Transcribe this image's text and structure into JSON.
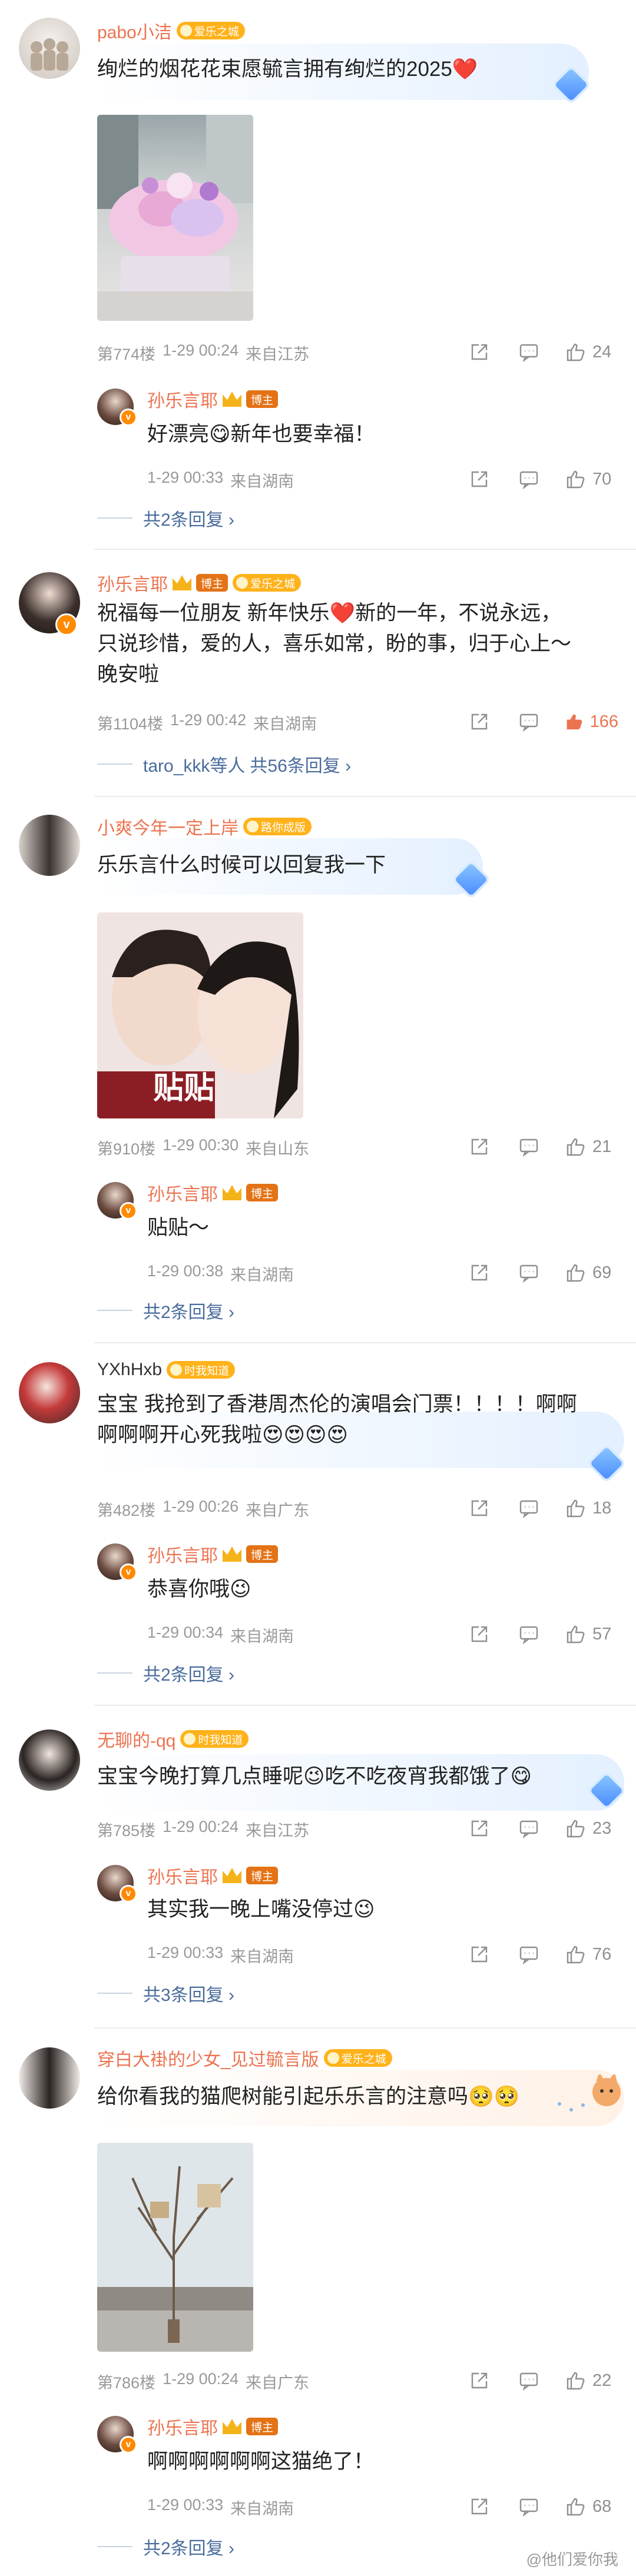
{
  "colors": {
    "name": "#eb7350",
    "meta": "#999999",
    "link": "#4a6c9b",
    "hot": "#eb7350"
  },
  "icons": {
    "share": "share-icon",
    "comment": "comment-icon",
    "like": "thumbs-up-icon"
  },
  "comments": [
    {
      "name": "pabo小洁",
      "tag": "爱乐之城",
      "text": "绚烂的烟花花束愿毓言拥有绚烂的2025❤️",
      "floor": "第774楼",
      "date": "1-29 00:24",
      "loc": "来自江苏",
      "likes": "24",
      "reply": {
        "name": "孙乐言耶",
        "host": "博主",
        "text": "好漂亮😋新年也要幸福！",
        "date": "1-29 00:33",
        "loc": "来自湖南",
        "likes": "70"
      },
      "more": "共2条回复 ›"
    },
    {
      "name": "孙乐言耶",
      "host": "博主",
      "tag": "爱乐之城",
      "text": "祝福每一位朋友 新年快乐❤️新的一年，不说永远，只说珍惜，爱的人，喜乐如常，盼的事，归于心上～晚安啦",
      "floor": "第1104楼",
      "date": "1-29 00:42",
      "loc": "来自湖南",
      "likes": "166",
      "more_prefix": "taro_kkk等人",
      "more": "共56条回复 ›"
    },
    {
      "name": "小爽今年一定上岸",
      "tag": "路你成版",
      "text": "乐乐言什么时候可以回复我一下",
      "image_text": "贴贴",
      "floor": "第910楼",
      "date": "1-29 00:30",
      "loc": "来自山东",
      "likes": "21",
      "reply": {
        "name": "孙乐言耶",
        "host": "博主",
        "text": "贴贴～",
        "date": "1-29 00:38",
        "loc": "来自湖南",
        "likes": "69"
      },
      "more": "共2条回复 ›"
    },
    {
      "name": "YXhHxb",
      "tag": "时我知道",
      "text": "宝宝 我抢到了香港周杰伦的演唱会门票！！！！啊啊啊啊啊开心死我啦😍😍😍😍",
      "floor": "第482楼",
      "date": "1-29 00:26",
      "loc": "来自广东",
      "likes": "18",
      "reply": {
        "name": "孙乐言耶",
        "host": "博主",
        "text": "恭喜你哦😉",
        "date": "1-29 00:34",
        "loc": "来自湖南",
        "likes": "57"
      },
      "more": "共2条回复 ›"
    },
    {
      "name": "无聊的-qq",
      "tag": "时我知道",
      "text": "宝宝今晚打算几点睡呢😉吃不吃夜宵我都饿了😋",
      "floor": "第785楼",
      "date": "1-29 00:24",
      "loc": "来自江苏",
      "likes": "23",
      "reply": {
        "name": "孙乐言耶",
        "host": "博主",
        "text": "其实我一晚上嘴没停过😉",
        "date": "1-29 00:33",
        "loc": "来自湖南",
        "likes": "76"
      },
      "more": "共3条回复 ›"
    },
    {
      "name": "穿白大褂的少女_见过毓言版",
      "tag": "爱乐之城",
      "text": "给你看我的猫爬树能引起乐乐言的注意吗🥺🥺",
      "floor": "第786楼",
      "date": "1-29 00:24",
      "loc": "来自广东",
      "likes": "22",
      "reply": {
        "name": "孙乐言耶",
        "host": "博主",
        "text": "啊啊啊啊啊啊这猫绝了！",
        "date": "1-29 00:33",
        "loc": "来自湖南",
        "likes": "68"
      },
      "more": "共2条回复 ›"
    }
  ],
  "watermark": "@他们爱你我"
}
